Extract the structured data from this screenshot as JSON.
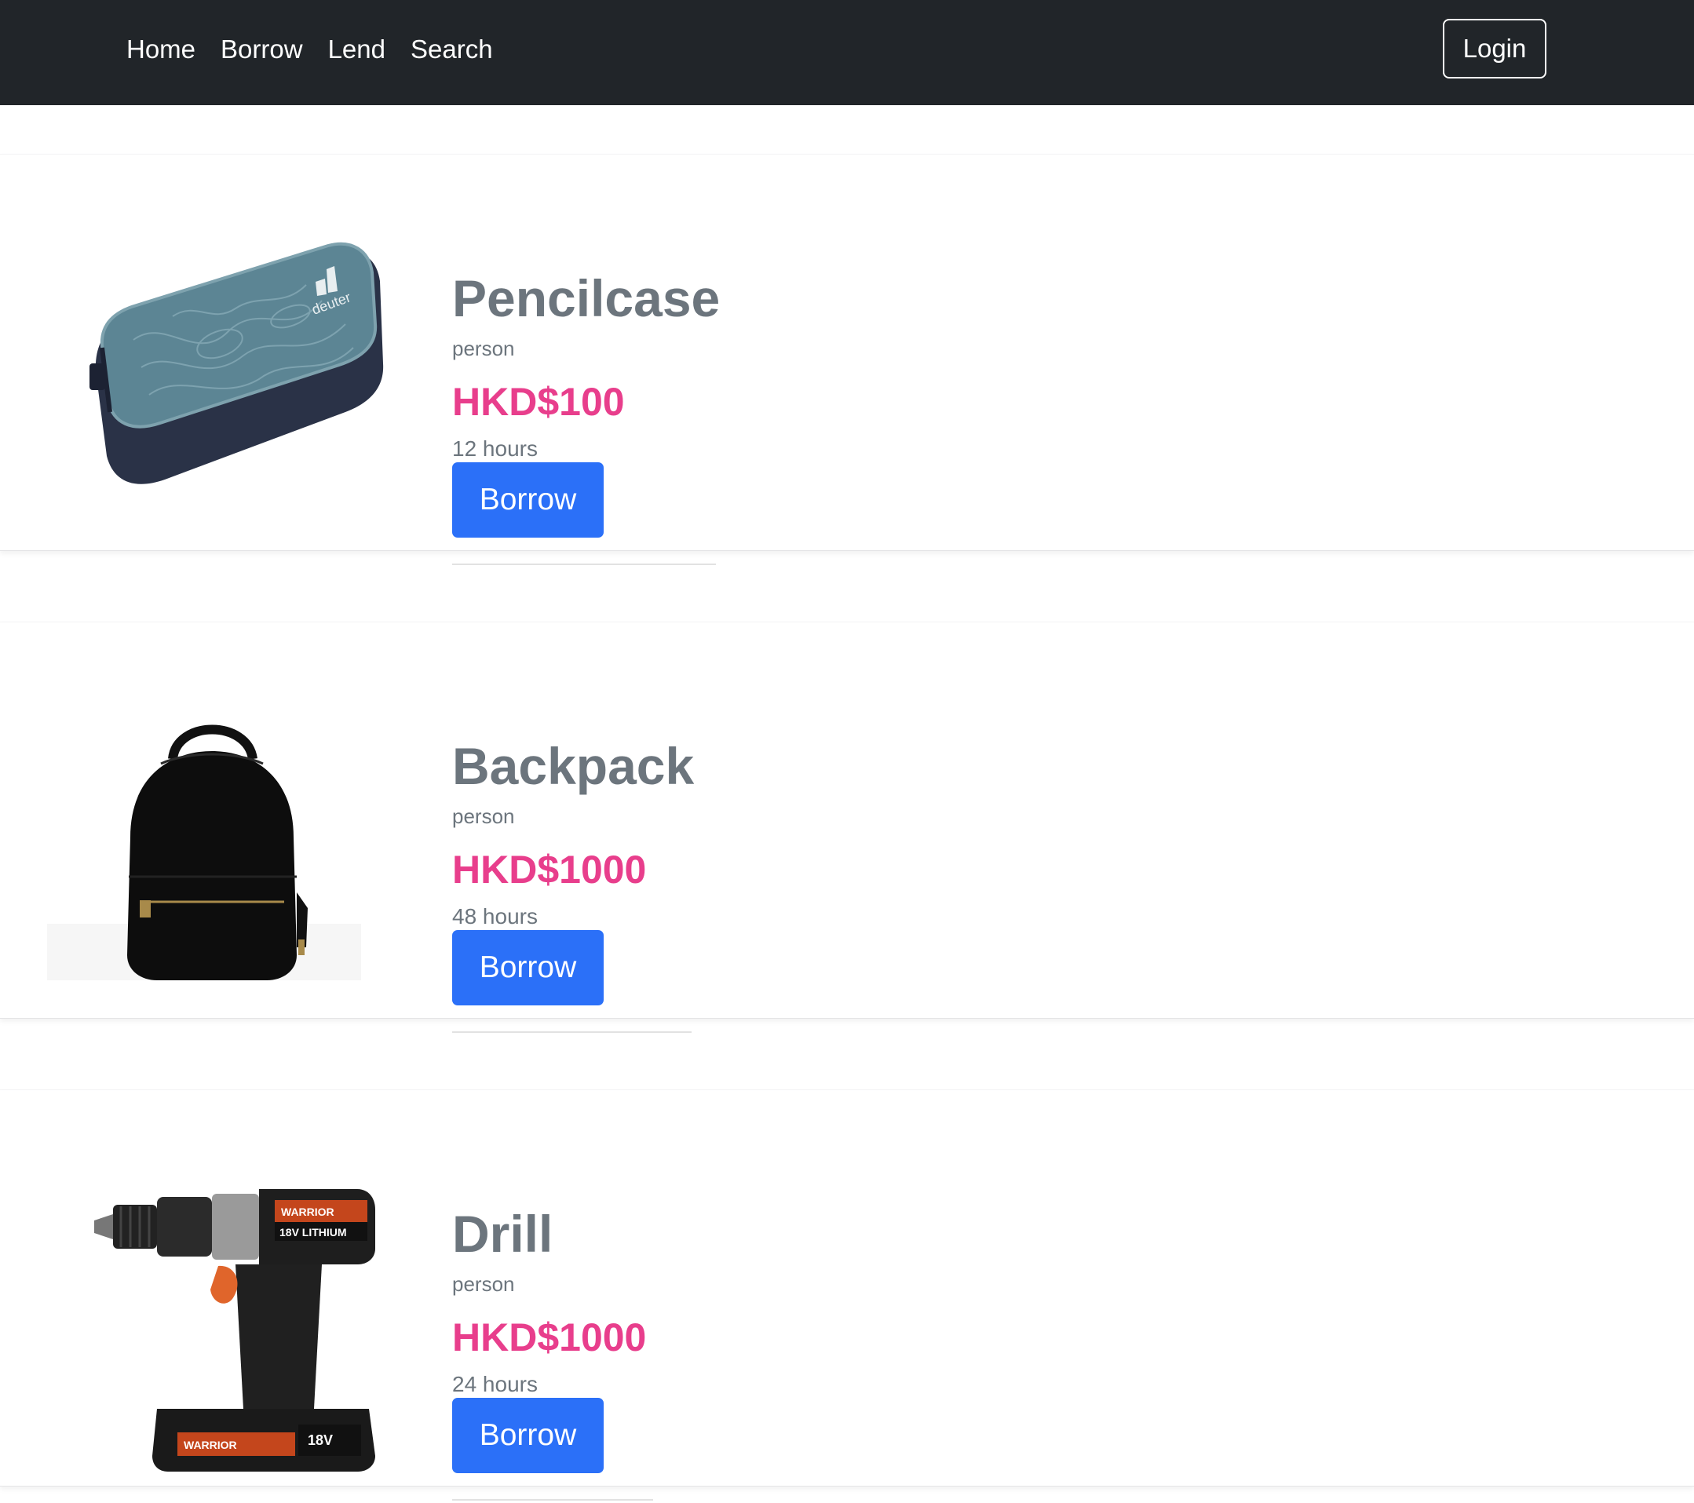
{
  "navbar": {
    "links": [
      {
        "label": "Home"
      },
      {
        "label": "Borrow"
      },
      {
        "label": "Lend"
      },
      {
        "label": "Search"
      }
    ],
    "login_label": "Login"
  },
  "items": [
    {
      "name": "Pencilcase",
      "owner": "person",
      "price": "HKD$100",
      "duration": "12 hours",
      "button_label": "Borrow",
      "image": "pencilcase-image"
    },
    {
      "name": "Backpack",
      "owner": "person",
      "price": "HKD$1000",
      "duration": "48 hours",
      "button_label": "Borrow",
      "image": "backpack-image"
    },
    {
      "name": "Drill",
      "owner": "person",
      "price": "HKD$1000",
      "duration": "24 hours",
      "button_label": "Borrow",
      "image": "drill-image"
    }
  ],
  "colors": {
    "navbar_bg": "#212529",
    "title_gray": "#6c757d",
    "price_pink": "#e83e8c",
    "button_blue": "#2b70f8"
  }
}
